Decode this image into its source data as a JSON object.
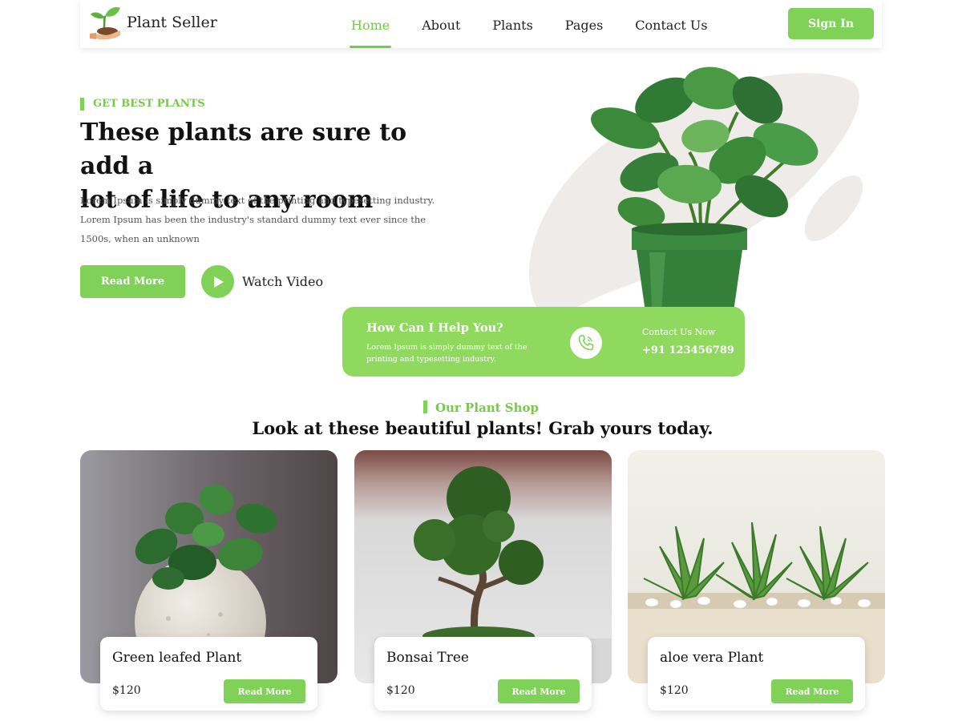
{
  "header": {
    "logo_text": "Plant Seller",
    "nav": [
      "Home",
      "About",
      "Plants",
      "Pages",
      "Contact Us"
    ],
    "active_nav": "Home",
    "sign_in": "Sign In"
  },
  "hero": {
    "eyebrow": "GET BEST PLANTS",
    "title_line1": "These plants are sure  to add a",
    "title_line2": "lot of life to any room",
    "desc_line1": "Lorem Ipsum is simply dummy text of the printing and  typesetting industry.",
    "desc_line2": "Lorem Ipsum has been the industry's  standard dummy text ever since the",
    "desc_line3": "1500s, when an unknown",
    "read_more": "Read More",
    "watch_video": "Watch Video"
  },
  "help": {
    "title": "How Can I Help You?",
    "desc_line1": "Lorem Ipsum is simply dummy text of the",
    "desc_line2": "printing and typesetting industry.",
    "contact_label": "Contact Us Now",
    "phone": "+91 123456789"
  },
  "shop": {
    "eyebrow": "Our Plant Shop",
    "title": "Look at these beautiful plants!  Grab yours today."
  },
  "products": [
    {
      "name": "Green leafed Plant",
      "price": "$120",
      "button": "Read More"
    },
    {
      "name": "Bonsai Tree",
      "price": "$120",
      "button": "Read More"
    },
    {
      "name": "aloe vera Plant",
      "price": "$120",
      "button": "Read More"
    }
  ],
  "colors": {
    "accent": "#80d158",
    "accent_text": "#77c94a",
    "help_bar": "#8fd95f",
    "blob": "#eeebe8"
  },
  "icons": [
    "logo-hand-sprout-icon",
    "play-icon",
    "phone-icon"
  ]
}
